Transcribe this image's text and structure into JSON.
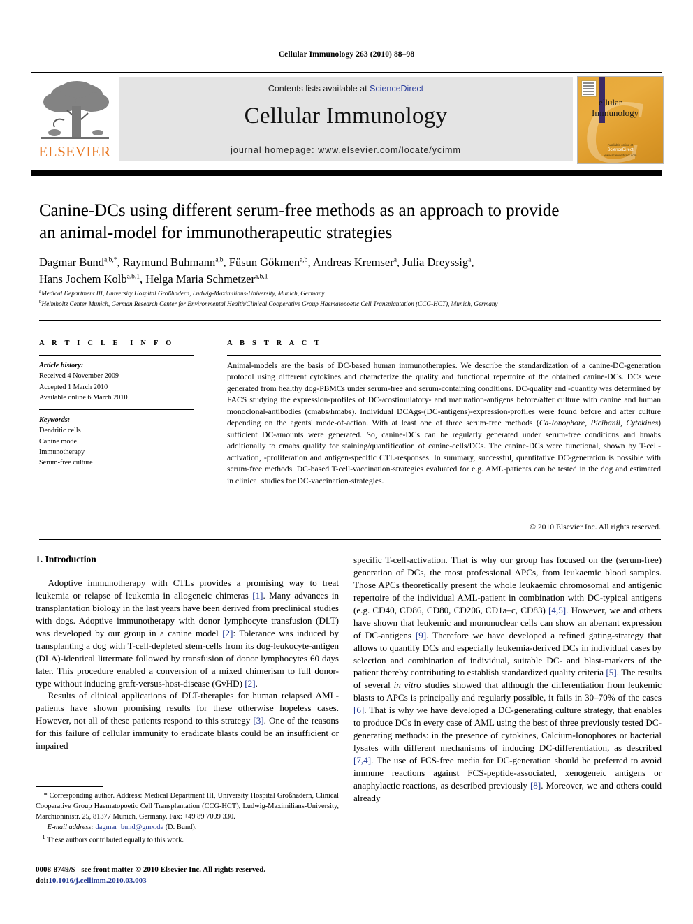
{
  "running_head": "Cellular Immunology 263 (2010) 88–98",
  "header": {
    "contents_prefix": "Contents lists available at ",
    "sciencedirect": "ScienceDirect",
    "journal_title": "Cellular Immunology",
    "homepage": "journal homepage: www.elsevier.com/locate/ycimm",
    "publisher_logo_text": "ELSEVIER",
    "cover": {
      "line1": "ellular",
      "line2": "Immunology",
      "footer_line1": "Available online at",
      "footer_line2": "ScienceDirect",
      "footer_line3": "www.sciencedirect.com"
    },
    "accent_link_color": "#2c3f9e",
    "band_color": "#e4e4e4",
    "elsevier_orange": "#e87722"
  },
  "article": {
    "title_line1": "Canine-DCs using different serum-free methods as an approach to provide",
    "title_line2": "an animal-model for immunotherapeutic strategies",
    "authors_line1": "Dagmar Bund a,b,*, Raymund Buhmann a,b, Füsun Gökmen a,b, Andreas Kremser a, Julia Dreyssig a,",
    "authors_line2": "Hans Jochem Kolb a,b,1, Helga Maria Schmetzer a,b,1",
    "affiliation_a": "Medical Department III, University Hospital Großhadern, Ludwig-Maximilians-University, Munich, Germany",
    "affiliation_b": "Helmholtz Center Munich, German Research Center for Environmental Health/Clinical Cooperative Group Haematopoetic Cell Transplantation (CCG-HCT), Munich, Germany"
  },
  "info": {
    "heading": "ARTICLE INFO",
    "history_label": "Article history:",
    "history": [
      "Received 4 November 2009",
      "Accepted 1 March 2010",
      "Available online 6 March 2010"
    ],
    "keywords_label": "Keywords:",
    "keywords": [
      "Dendritic cells",
      "Canine model",
      "Immunotherapy",
      "Serum-free culture"
    ]
  },
  "abstract": {
    "heading": "ABSTRACT",
    "text_part1": "Animal-models are the basis of DC-based human immunotherapies. We describe the standardization of a canine-DC-generation protocol using different cytokines and characterize the quality and functional repertoire of the obtained canine-DCs. DCs were generated from healthy dog-PBMCs under serum-free and serum-containing conditions. DC-quality and -quantity was determined by FACS studying the expression-profiles of DC-/costimulatory- and maturation-antigens before/after culture with canine and human monoclonal-antibodies (cmabs/hmabs). Individual DCAgs-(DC-antigens)-expression-profiles were found before and after culture depending on the agents' mode-of-action. With at least one of three serum-free methods (",
    "italic1": "Ca-Ionophore, Picibanil, Cytokines",
    "text_part2": ") sufficient DC-amounts were generated. So, canine-DCs can be regularly generated under serum-free conditions and hmabs additionally to cmabs qualify for staining/quantification of canine-cells/DCs. The canine-DCs were functional, shown by T-cell-activation, -proliferation and antigen-specific CTL-responses. In summary, successful, quantitative DC-generation is possible with serum-free methods. DC-based T-cell-vaccination-strategies evaluated for e.g. AML-patients can be tested in the dog and estimated in clinical studies for DC-vaccination-strategies.",
    "copyright": "© 2010 Elsevier Inc. All rights reserved."
  },
  "body": {
    "section_heading": "1. Introduction",
    "left_paragraph_1": "Adoptive immunotherapy with CTLs provides a promising way to treat leukemia or relapse of leukemia in allogeneic chimeras [1]. Many advances in transplantation biology in the last years have been derived from preclinical studies with dogs. Adoptive immunotherapy with donor lymphocyte transfusion (DLT) was developed by our group in a canine model [2]: Tolerance was induced by transplanting a dog with T-cell-depleted stem-cells from its dog-leukocyte-antigen (DLA)-identical littermate followed by transfusion of donor lymphocytes 60 days later. This procedure enabled a conversion of a mixed chimerism to full donor-type without inducing graft-versus-host-disease (GvHD) [2].",
    "left_paragraph_2": "Results of clinical applications of DLT-therapies for human relapsed AML-patients have shown promising results for these otherwise hopeless cases. However, not all of these patients respond to this strategy [3]. One of the reasons for this failure of cellular immunity to eradicate blasts could be an insufficient or impaired",
    "right_paragraph": "specific T-cell-activation. That is why our group has focused on the (serum-free) generation of DCs, the most professional APCs, from leukaemic blood samples. Those APCs theoretically present the whole leukaemic chromosomal and antigenic repertoire of the individual AML-patient in combination with DC-typical antigens (e.g. CD40, CD86, CD80, CD206, CD1a–c, CD83) [4,5]. However, we and others have shown that leukemic and mononuclear cells can show an aberrant expression of DC-antigens [9]. Therefore we have developed a refined gating-strategy that allows to quantify DCs and especially leukemia-derived DCs in individual cases by selection and combination of individual, suitable DC- and blast-markers of the patient thereby contributing to establish standardized quality criteria [5]. The results of several in vitro studies showed that although the differentiation from leukemic blasts to APCs is principally and regularly possible, it fails in 30–70% of the cases [6]. That is why we have developed a DC-generating culture strategy, that enables to produce DCs in every case of AML using the best of three previously tested DC-generating methods: in the presence of cytokines, Calcium-Ionophores or bacterial lysates with different mechanisms of inducing DC-differentiation, as described [7,4]. The use of FCS-free media for DC-generation should be preferred to avoid immune reactions against FCS-peptide-associated, xenogeneic antigens or anaphylactic reactions, as described previously [8]. Moreover, we and others could already"
  },
  "footnotes": {
    "corresponding": "* Corresponding author. Address: Medical Department III, University Hospital Großhadern, Clinical Cooperative Group Haematopoetic Cell Transplantation (CCG-HCT), Ludwig-Maximilians-University, Marchioninistr. 25, 81377 Munich, Germany. Fax: +49 89 7099 330.",
    "email_label": "E-mail address:",
    "email": "dagmar_bund@gmx.de",
    "email_suffix": "(D. Bund).",
    "equal_contrib": "1 These authors contributed equally to this work."
  },
  "imprint": {
    "line1": "0008-8749/$ - see front matter © 2010 Elsevier Inc. All rights reserved.",
    "doi_prefix": "doi:",
    "doi": "10.1016/j.cellimm.2010.03.003"
  }
}
